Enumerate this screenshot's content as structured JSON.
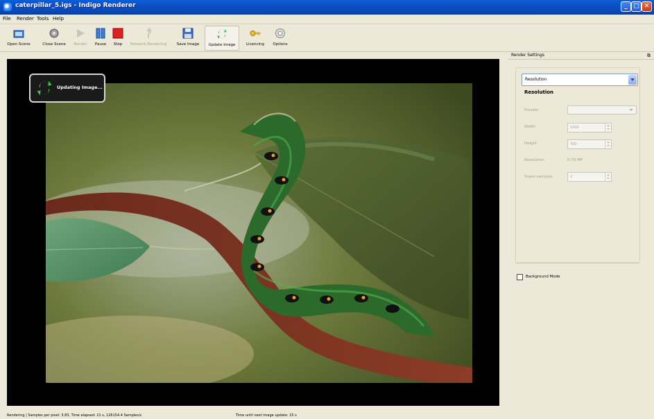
{
  "window": {
    "title": "caterpillar_5.igs - Indigo Renderer"
  },
  "menu": {
    "items": [
      "File",
      "Render",
      "Tools",
      "Help"
    ]
  },
  "toolbar": {
    "buttons": [
      {
        "label": "Open Scene",
        "icon": "open-scene-icon",
        "enabled": true
      },
      {
        "label": "Close Scene",
        "icon": "close-scene-icon",
        "enabled": true
      },
      {
        "label": "Render",
        "icon": "play-icon",
        "enabled": false
      },
      {
        "label": "Pause",
        "icon": "pause-icon",
        "enabled": true
      },
      {
        "label": "Stop",
        "icon": "stop-icon",
        "enabled": true
      },
      {
        "label": "Network Rendering",
        "icon": "network-icon",
        "enabled": false
      },
      {
        "label": "Save Image",
        "icon": "save-icon",
        "enabled": true
      },
      {
        "label": "Update Image",
        "icon": "refresh-icon",
        "enabled": true,
        "active": true
      },
      {
        "label": "Licencing",
        "icon": "key-icon",
        "enabled": true
      },
      {
        "label": "Options",
        "icon": "gear-icon",
        "enabled": true
      }
    ]
  },
  "overlay": {
    "updating_text": "Updating Image..."
  },
  "panel": {
    "title": "Render Settings",
    "combo_value": "Resolution",
    "section_title": "Resolution",
    "rows": {
      "presets_label": "Presets",
      "width_label": "Width",
      "width_value": "1000",
      "height_label": "Height",
      "height_value": "700",
      "resolution_label": "Resolution",
      "resolution_value": "0.70 MP",
      "supersamples_label": "Super-samples",
      "supersamples_value": "2"
    },
    "background_mode_label": "Background Mode",
    "background_mode_checked": false
  },
  "status": {
    "left": "Rendering | Samples per pixel: 3.83, Time elapsed: 21 s, 126154.4 Samples/s",
    "right": "Time until next image update: 15 s"
  },
  "colors": {
    "titlebar": "#0a4fc4",
    "chrome": "#ece9d8",
    "render_bg": "#000000"
  }
}
